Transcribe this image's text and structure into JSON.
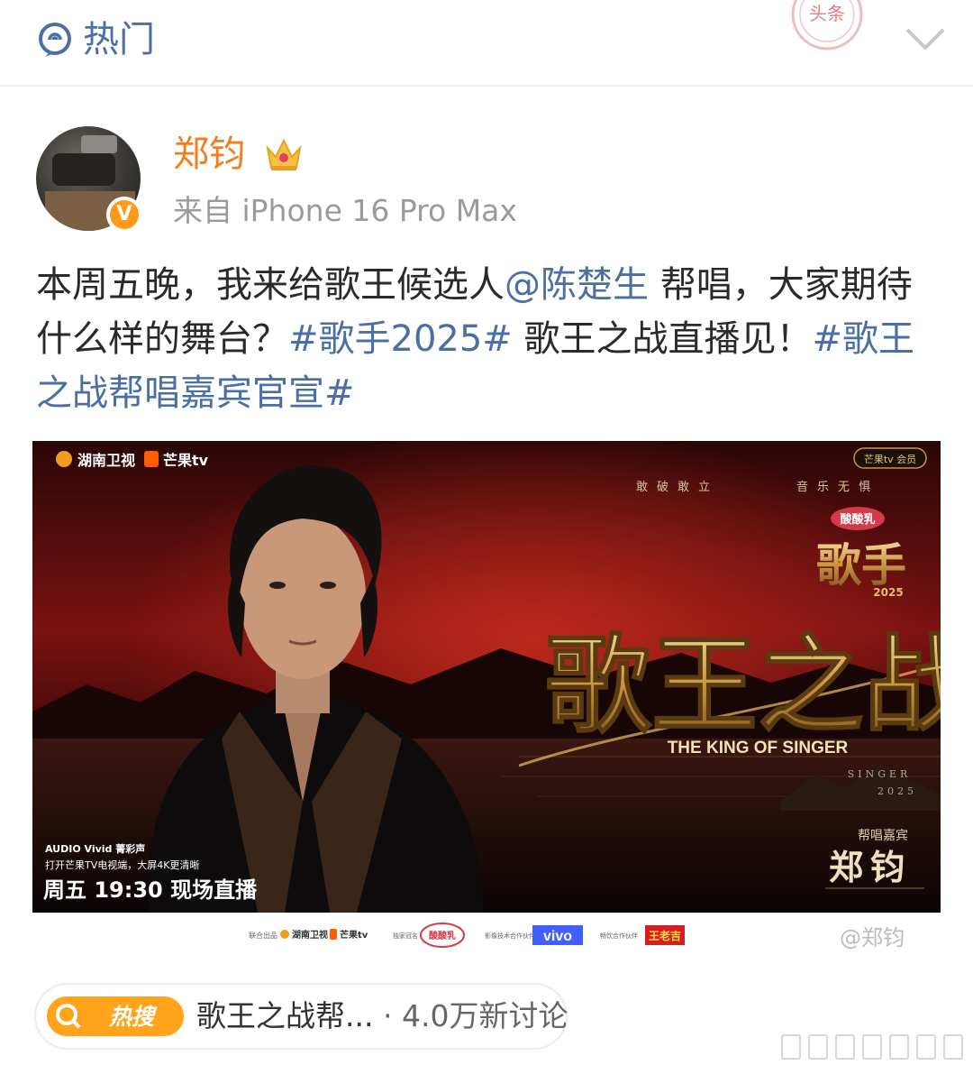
{
  "header": {
    "title": "热门",
    "stamp_text": "头条",
    "icons": {
      "hot": "hot-topic-icon",
      "stamp": "stamp-icon",
      "collapse": "chevron-down-icon"
    }
  },
  "post": {
    "author": {
      "name": "郑钧",
      "source": "来自 iPhone 16 Pro Max",
      "verified_badge": "V",
      "crown_icon": "crown-icon"
    },
    "text": {
      "part1": "本周五晚，我来给歌王候选人",
      "mention": "@陈楚生",
      "part2": " 帮唱，大家期待什么样的舞台？",
      "hashtag1": "#歌手2025#",
      "part3": " 歌王之战直播见！",
      "hashtag2": "#歌王之战帮唱嘉宾官宣#"
    },
    "image": {
      "logo_hunan": "湖南卫视",
      "logo_mango": "芒果tv",
      "member_badge": "芒果tv 会员",
      "slogan_left": "敢破敢立",
      "slogan_right": "音乐无惧",
      "sponsor": "酸酸乳",
      "show_name": "歌手",
      "show_year": "2025",
      "headline": "歌王之战",
      "subtitle_en": "THE KING OF SINGER",
      "singer_en": "SINGER",
      "singer_year": "2025",
      "guest_label": "帮唱嘉宾",
      "guest_name": "郑钧",
      "audio_brand": "AUDIO Vivid 菁彩声",
      "audio_tip": "打开芒果TV电视端，大屏4K更清晰",
      "schedule": "周五 19:30 现场直播",
      "footer": {
        "co_label": "联合出品",
        "co_hunan": "湖南卫视",
        "co_mango": "芒果tv",
        "sponsor_label": "独家冠名",
        "sponsor_brand": "酸酸乳",
        "tech_label": "影像技术合作伙伴",
        "tech_brand": "vivo",
        "drink_label": "畅饮合作伙伴",
        "drink_brand": "王老吉"
      },
      "watermark": "@郑钧"
    },
    "hot_search": {
      "tag": "热搜",
      "title": "歌王之战帮...",
      "separator": "·",
      "count": "4.0万新讨论"
    }
  }
}
